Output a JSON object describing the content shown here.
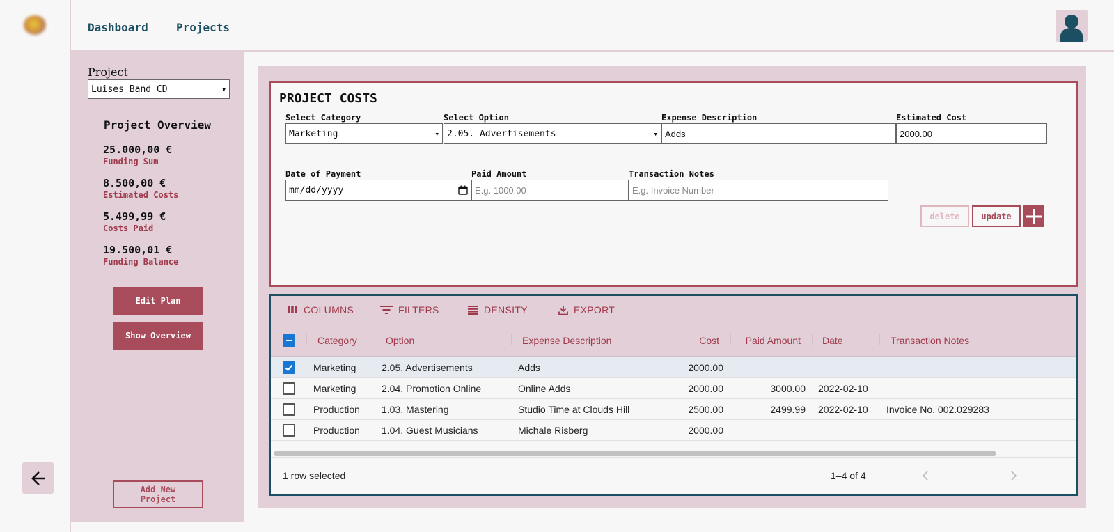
{
  "header": {
    "nav": [
      "Dashboard",
      "Projects"
    ]
  },
  "sidebar": {
    "project_label": "Project",
    "project_value": "Luises Band CD",
    "overview_title": "Project Overview",
    "stats": [
      {
        "value": "25.000,00 €",
        "label": "Funding Sum"
      },
      {
        "value": "8.500,00 €",
        "label": "Estimated Costs"
      },
      {
        "value": "5.499,99 €",
        "label": "Costs Paid"
      },
      {
        "value": "19.500,01 €",
        "label": "Funding Balance"
      }
    ],
    "edit_plan": "Edit Plan",
    "show_overview": "Show Overview",
    "add_new_project_line1": "Add New",
    "add_new_project_line2": "Project"
  },
  "costs": {
    "title": "PROJECT COSTS",
    "category_label": "Select Category",
    "category_value": "Marketing",
    "option_label": "Select Option",
    "option_value": "2.05. Advertisements",
    "description_label": "Expense Description",
    "description_value": "Adds",
    "estimated_label": "Estimated Cost",
    "estimated_value": "2000.00",
    "date_label": "Date of Payment",
    "date_placeholder": "mm/dd/yyyy",
    "paid_label": "Paid Amount",
    "paid_placeholder": "E.g. 1000,00",
    "notes_label": "Transaction Notes",
    "notes_placeholder": "E.g. Invoice Number",
    "delete": "delete",
    "update": "update"
  },
  "grid": {
    "toolbar": [
      "COLUMNS",
      "FILTERS",
      "DENSITY",
      "EXPORT"
    ],
    "columns": [
      "Category",
      "Option",
      "Expense Description",
      "Cost",
      "Paid Amount",
      "Date",
      "Transaction Notes"
    ],
    "rows": [
      {
        "checked": true,
        "cells": [
          "Marketing",
          "2.05. Advertisements",
          "Adds",
          "2000.00",
          "",
          "",
          ""
        ]
      },
      {
        "checked": false,
        "cells": [
          "Marketing",
          "2.04. Promotion Online",
          "Online Adds",
          "2000.00",
          "3000.00",
          "2022-02-10",
          ""
        ]
      },
      {
        "checked": false,
        "cells": [
          "Production",
          "1.03. Mastering",
          "Studio Time at Clouds Hill",
          "2500.00",
          "2499.99",
          "2022-02-10",
          "Invoice No. 002.029283"
        ]
      },
      {
        "checked": false,
        "cells": [
          "Production",
          "1.04. Guest Musicians",
          "Michale Risberg",
          "2000.00",
          "",
          "",
          ""
        ]
      }
    ],
    "selected_text": "1 row selected",
    "pagination": "1–4 of 4"
  },
  "colors": {
    "accent": "#a84b5a",
    "panel": "#e2cfd8",
    "navy": "#1d4f63",
    "checkbox": "#1976d2"
  }
}
